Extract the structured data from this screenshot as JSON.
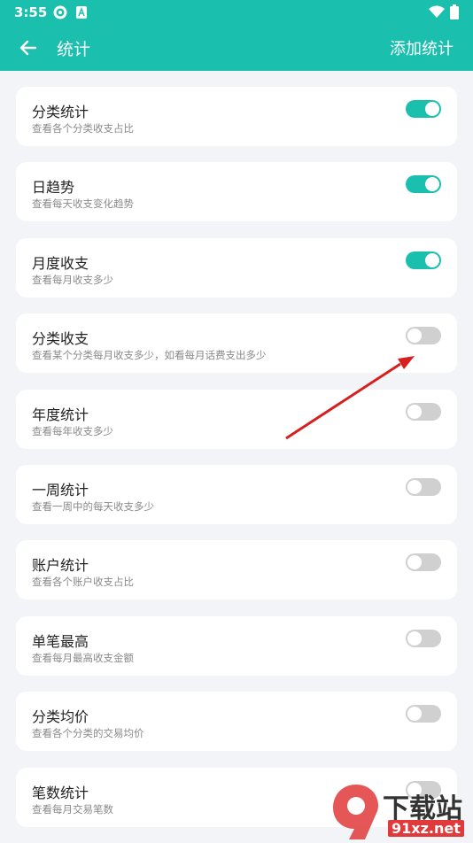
{
  "status": {
    "time": "3:55"
  },
  "appbar": {
    "title": "统计",
    "action": "添加统计"
  },
  "items": [
    {
      "label": "分类统计",
      "desc": "查看各个分类收支占比",
      "enabled": true
    },
    {
      "label": "日趋势",
      "desc": "查看每天收支变化趋势",
      "enabled": true
    },
    {
      "label": "月度收支",
      "desc": "查看每月收支多少",
      "enabled": true
    },
    {
      "label": "分类收支",
      "desc": "查看某个分类每月收支多少，如看每月话费支出多少",
      "enabled": false
    },
    {
      "label": "年度统计",
      "desc": "查看每年收支多少",
      "enabled": false
    },
    {
      "label": "一周统计",
      "desc": "查看一周中的每天收支多少",
      "enabled": false
    },
    {
      "label": "账户统计",
      "desc": "查看各个账户收支占比",
      "enabled": false
    },
    {
      "label": "单笔最高",
      "desc": "查看每月最高收支金额",
      "enabled": false
    },
    {
      "label": "分类均价",
      "desc": "查看各个分类的交易均价",
      "enabled": false
    },
    {
      "label": "笔数统计",
      "desc": "查看每月交易笔数",
      "enabled": false
    }
  ],
  "watermark": {
    "brand": "下载站",
    "site": "91xz.net"
  },
  "colors": {
    "accent": "#1bbfae",
    "toggle_off": "#d0d0d0",
    "arrow": "#d62020"
  }
}
